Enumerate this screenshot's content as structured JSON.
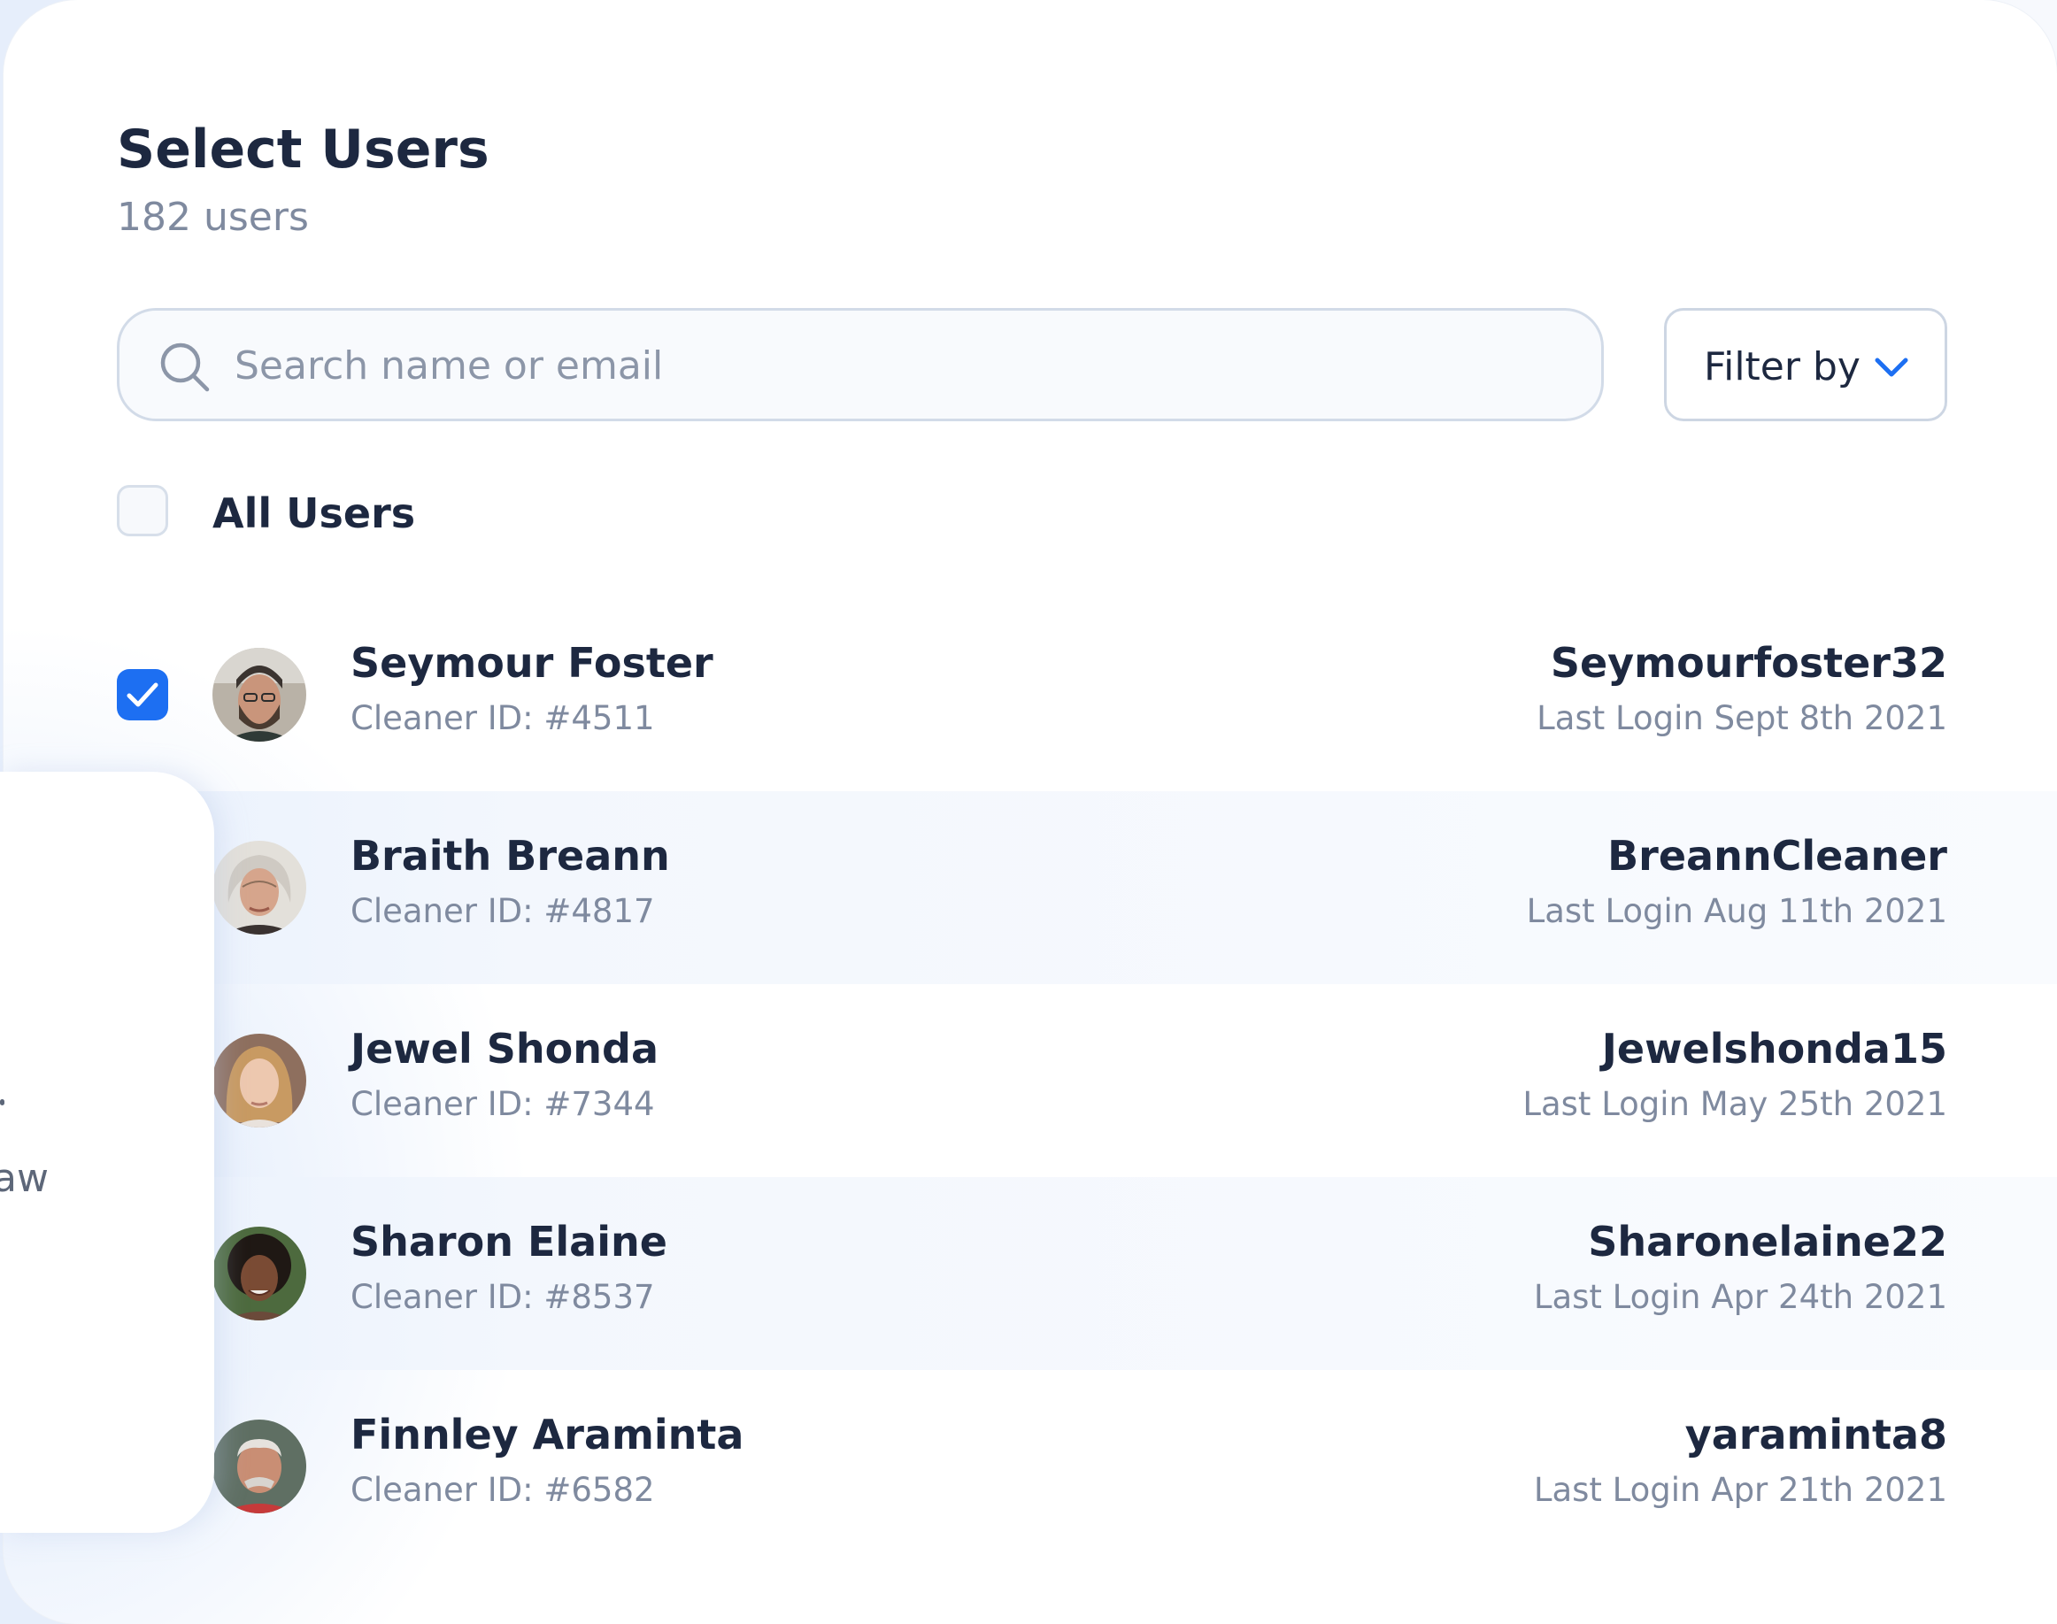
{
  "header": {
    "title": "Select Users",
    "count": "182 users"
  },
  "search": {
    "placeholder": "Search name or email",
    "value": ""
  },
  "filter": {
    "label": "Filter by"
  },
  "all_users": {
    "label": "All Users",
    "checked": false
  },
  "users": [
    {
      "name": "Seymour Foster",
      "id_text": "Cleaner ID: #4511",
      "username": "Seymourfoster32",
      "last_login": "Last Login Sept 8th 2021",
      "checked": true
    },
    {
      "name": "Braith Breann",
      "id_text": "Cleaner ID: #4817",
      "username": "BreannCleaner",
      "last_login": "Last Login Aug 11th 2021",
      "checked": false
    },
    {
      "name": "Jewel Shonda",
      "id_text": "Cleaner ID: #7344",
      "username": "Jewelshonda15",
      "last_login": "Last Login May 25th 2021",
      "checked": false
    },
    {
      "name": "Sharon Elaine",
      "id_text": "Cleaner ID: #8537",
      "username": "Sharonelaine22",
      "last_login": "Last Login Apr 24th 2021",
      "checked": false
    },
    {
      "name": "Finnley Araminta",
      "id_text": "Cleaner ID: #6582",
      "username": "yaraminta8",
      "last_login": "Last Login Apr 21th 2021",
      "checked": false
    }
  ],
  "overlay": {
    "text": "aw"
  },
  "colors": {
    "accent": "#1d6ff2",
    "text_primary": "#1d2840",
    "text_secondary": "#7f8a9f"
  },
  "icons": {
    "search": "search-icon",
    "filter": "chevron-down-icon",
    "check": "check-icon"
  }
}
